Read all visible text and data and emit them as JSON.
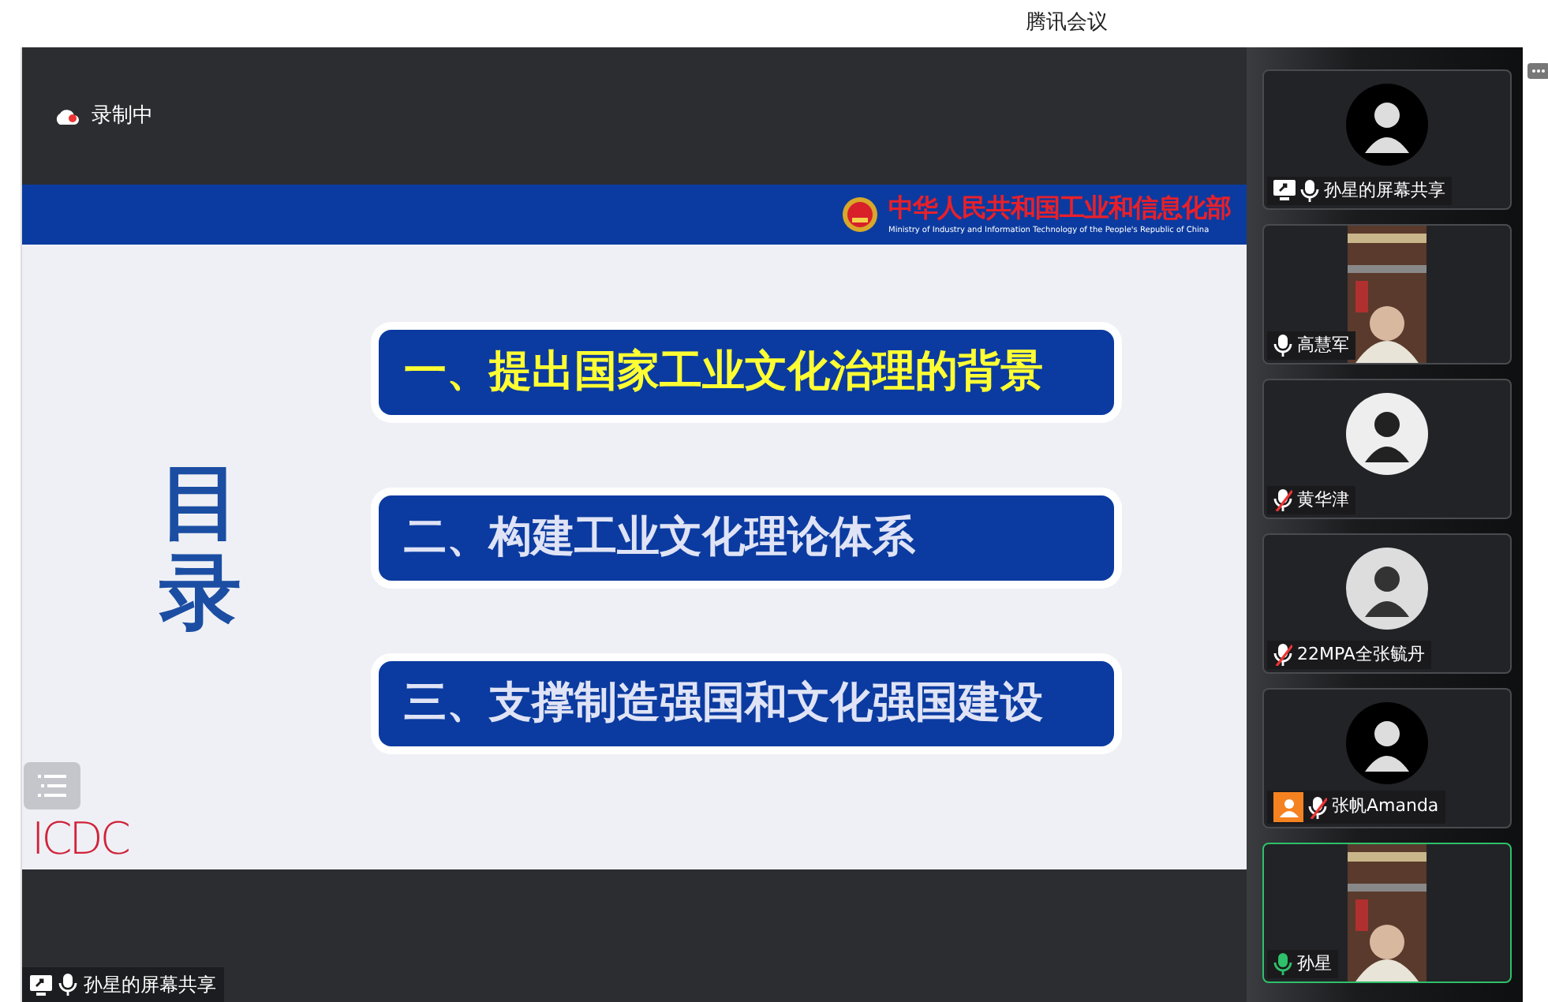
{
  "window": {
    "title": "腾讯会议"
  },
  "recording": {
    "label": "录制中"
  },
  "slide": {
    "header": {
      "title_cn": "中华人民共和国工业和信息化部",
      "title_en": "Ministry of Industry and Information Technology of the People's Republic of China"
    },
    "heading": "目录",
    "items": [
      {
        "text": "一、提出国家工业文化治理的背景",
        "highlighted": true
      },
      {
        "text": "二、构建工业文化理论体系",
        "highlighted": false
      },
      {
        "text": "三、支撑制造强国和文化强国建设",
        "highlighted": false
      }
    ],
    "logo_text": "ICDC"
  },
  "share_label": {
    "name": "孙星的屏幕共享",
    "sharing": true,
    "muted": false
  },
  "participants": [
    {
      "name": "孙星的屏幕共享",
      "kind": "avatar",
      "muted": false,
      "speaking": false,
      "sharing": true,
      "host": false,
      "selected": false
    },
    {
      "name": "高慧军",
      "kind": "video",
      "muted": false,
      "speaking": false,
      "sharing": false,
      "host": false,
      "selected": false
    },
    {
      "name": "黄华津",
      "kind": "avatar",
      "muted": true,
      "speaking": false,
      "sharing": false,
      "host": false,
      "selected": false
    },
    {
      "name": "22MPA全张毓丹",
      "kind": "avatar",
      "muted": true,
      "speaking": false,
      "sharing": false,
      "host": false,
      "selected": false
    },
    {
      "name": "张帆Amanda",
      "kind": "avatar",
      "muted": true,
      "speaking": false,
      "sharing": false,
      "host": true,
      "selected": false
    },
    {
      "name": "孙星",
      "kind": "video",
      "muted": false,
      "speaking": true,
      "sharing": false,
      "host": false,
      "selected": true
    }
  ]
}
